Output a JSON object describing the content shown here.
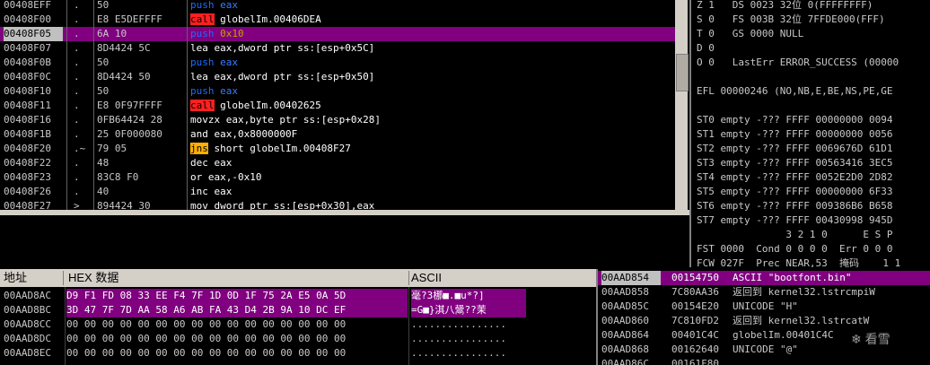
{
  "disasm": [
    {
      "addr": "00408EFF",
      "mark": ".",
      "hex": "50",
      "op": "push",
      "operand": "eax",
      "kind": "push"
    },
    {
      "addr": "00408F00",
      "mark": ".",
      "hex": "E8 E5DEFFFF",
      "op": "call",
      "operand": "globelIm.00406DEA",
      "kind": "call"
    },
    {
      "addr": "00408F05",
      "mark": ".",
      "hex": "6A 10",
      "op": "push",
      "operand": "0x10",
      "kind": "push",
      "selected": true
    },
    {
      "addr": "00408F07",
      "mark": ".",
      "hex": "8D4424 5C",
      "op": "lea",
      "operand": "eax,dword ptr ss:[esp+0x5C]",
      "kind": "plain"
    },
    {
      "addr": "00408F0B",
      "mark": ".",
      "hex": "50",
      "op": "push",
      "operand": "eax",
      "kind": "push"
    },
    {
      "addr": "00408F0C",
      "mark": ".",
      "hex": "8D4424 50",
      "op": "lea",
      "operand": "eax,dword ptr ss:[esp+0x50]",
      "kind": "plain"
    },
    {
      "addr": "00408F10",
      "mark": ".",
      "hex": "50",
      "op": "push",
      "operand": "eax",
      "kind": "push"
    },
    {
      "addr": "00408F11",
      "mark": ".",
      "hex": "E8 0F97FFFF",
      "op": "call",
      "operand": "globelIm.00402625",
      "kind": "call"
    },
    {
      "addr": "00408F16",
      "mark": ".",
      "hex": "0FB64424 28",
      "op": "movzx",
      "operand": "eax,byte ptr ss:[esp+0x28]",
      "kind": "plain"
    },
    {
      "addr": "00408F1B",
      "mark": ".",
      "hex": "25 0F000080",
      "op": "and",
      "operand": "eax,0x8000000F",
      "kind": "plain"
    },
    {
      "addr": "00408F20",
      "mark": ".~",
      "hex": "79 05",
      "op": "jns",
      "operand": "short globelIm.00408F27",
      "kind": "jmp"
    },
    {
      "addr": "00408F22",
      "mark": ".",
      "hex": "48",
      "op": "dec",
      "operand": "eax",
      "kind": "plain"
    },
    {
      "addr": "00408F23",
      "mark": ".",
      "hex": "83C8 F0",
      "op": "or",
      "operand": "eax,-0x10",
      "kind": "plain"
    },
    {
      "addr": "00408F26",
      "mark": ".",
      "hex": "40",
      "op": "inc",
      "operand": "eax",
      "kind": "plain"
    },
    {
      "addr": "00408F27",
      "mark": ">",
      "hex": "894424 30",
      "op": "mov",
      "operand": "dword ptr ss:[esp+0x30],eax",
      "kind": "plain"
    }
  ],
  "registers": [
    "Z 1   DS 0023 32位 0(FFFFFFFF)",
    "S 0   FS 003B 32位 7FFDE000(FFF)",
    "T 0   GS 0000 NULL",
    "D 0",
    "O 0   LastErr ERROR_SUCCESS (00000",
    "",
    "EFL 00000246 (NO,NB,E,BE,NS,PE,GE",
    "",
    "ST0 empty -??? FFFF 00000000 0094",
    "ST1 empty -??? FFFF 00000000 0056",
    "ST2 empty -??? FFFF 0069676D 61D1",
    "ST3 empty -??? FFFF 00563416 3EC5",
    "ST4 empty -??? FFFF 0052E2D0 2D82",
    "ST5 empty -??? FFFF 00000000 6F33",
    "ST6 empty -??? FFFF 009386B6 B658",
    "ST7 empty -??? FFFF 00430998 945D",
    "               3 2 1 0      E S P",
    "FST 0000  Cond 0 0 0 0  Err 0 0 0",
    "FCW 027F  Prec NEAR,53  掩码    1 1"
  ],
  "dump_header": {
    "address": "地址",
    "hex": "HEX 数据",
    "ascii": "ASCII"
  },
  "dump": [
    {
      "addr": "00AAD8AC",
      "hex": "D9 F1 FD 08 33 EE F4 7F 1D 0D 1F 75 2A E5 0A 5D",
      "ascii": "毫?3梛■.■u*?]",
      "selected": true
    },
    {
      "addr": "00AAD8BC",
      "hex": "3D 47 7F 7D AA 58 A6 AB FA 43 D4 2B 9A 10 DC EF",
      "ascii": "=G■}淇八鬶??茉",
      "selected": true
    },
    {
      "addr": "00AAD8CC",
      "hex": "00 00 00 00 00 00 00 00 00 00 00 00 00 00 00 00",
      "ascii": "................"
    },
    {
      "addr": "00AAD8DC",
      "hex": "00 00 00 00 00 00 00 00 00 00 00 00 00 00 00 00",
      "ascii": "................"
    },
    {
      "addr": "00AAD8EC",
      "hex": "00 00 00 00 00 00 00 00 00 00 00 00 00 00 00 00",
      "ascii": "................"
    }
  ],
  "stack": [
    {
      "addr": "00AAD854",
      "val": "00154750",
      "comment": "ASCII \"bootfont.bin\"",
      "selected": true
    },
    {
      "addr": "00AAD858",
      "val": "7C80AA36",
      "comment": "返回到 kernel32.lstrcmpiW"
    },
    {
      "addr": "00AAD85C",
      "val": "00154E20",
      "comment": "UNICODE \"H\""
    },
    {
      "addr": "00AAD860",
      "val": "7C810FD2",
      "comment": "返回到 kernel32.lstrcatW"
    },
    {
      "addr": "00AAD864",
      "val": "00401C4C",
      "comment": "globelIm.00401C4C"
    },
    {
      "addr": "00AAD868",
      "val": "00162640",
      "comment": "UNICODE \"@\""
    },
    {
      "addr": "00AAD86C",
      "val": "00161F80",
      "comment": ""
    }
  ],
  "watermark": "看雪"
}
